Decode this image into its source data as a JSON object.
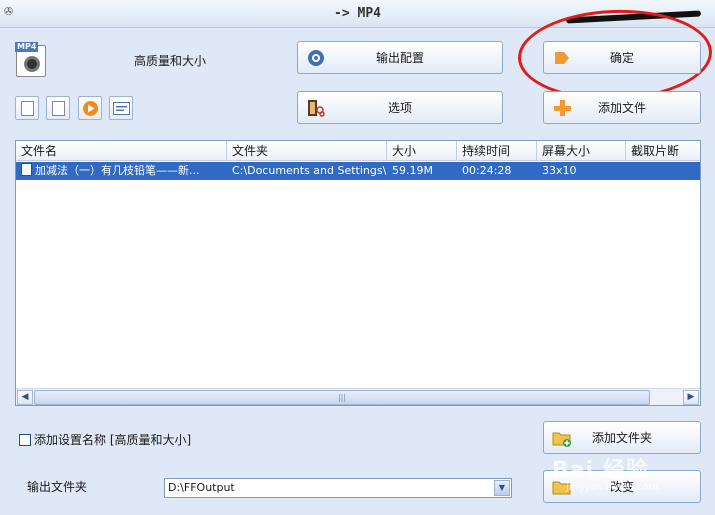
{
  "window": {
    "title": "-> MP4"
  },
  "profile": {
    "label": "高质量和大小"
  },
  "buttons": {
    "output_config": "输出配置",
    "ok": "确定",
    "options": "选项",
    "add_file": "添加文件",
    "add_folder": "添加文件夹",
    "change": "改变"
  },
  "file_list": {
    "columns": [
      "文件名",
      "文件夹",
      "大小",
      "持续时间",
      "屏幕大小",
      "截取片断"
    ],
    "rows": [
      {
        "name": "加减法（一）有几枝铅笔——新...",
        "folder": "C:\\Documents and Settings\\...",
        "size": "59.19M",
        "duration": "00:24:28",
        "screen": "33x10",
        "clip": ""
      }
    ]
  },
  "save_settings": {
    "label": "添加设置名称 [高质量和大小]",
    "checked": false
  },
  "output_folder": {
    "label": "输出文件夹",
    "value": "D:\\FFOutput"
  },
  "watermark": {
    "text": "Bai 经验",
    "sub": "jingyan.baidu.com"
  }
}
